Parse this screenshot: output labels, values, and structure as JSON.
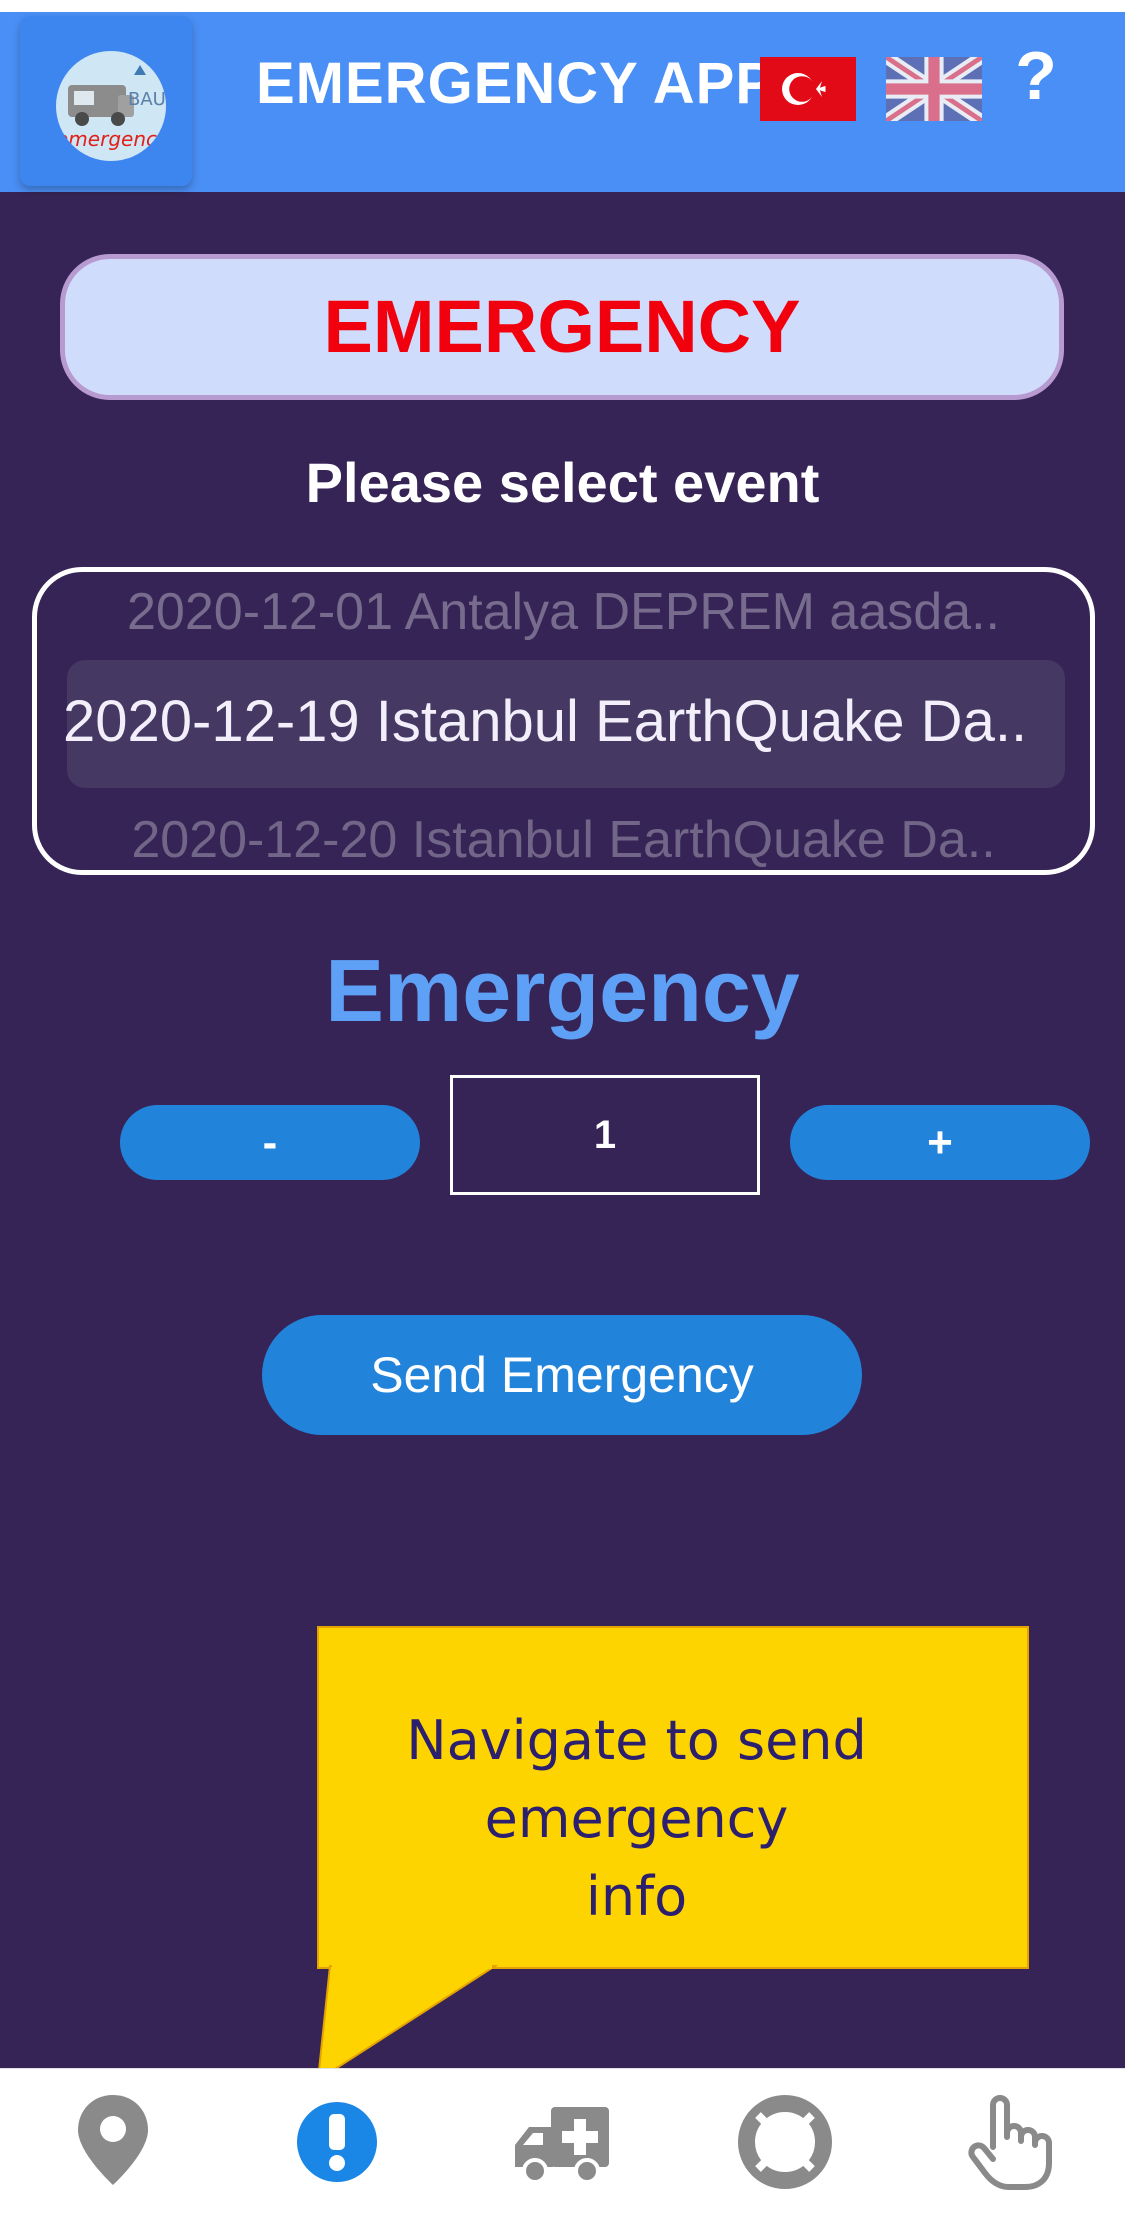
{
  "header": {
    "title": "EMERGENCY APP",
    "logo_text": "emergency",
    "logo_mark": "BAU",
    "help_label": "?",
    "languages": [
      {
        "name": "turkish-flag"
      },
      {
        "name": "uk-flag"
      }
    ]
  },
  "banner": {
    "label": "EMERGENCY"
  },
  "event_select": {
    "prompt": "Please select event",
    "options_visible": [
      "2020-12-01 Antalya DEPREM aasda..",
      "2020-12-19 Istanbul EarthQuake Da..",
      "2020-12-20 Istanbul EarthQuake Da.."
    ],
    "selected": "2020-12-19 Istanbul EarthQuake Da.."
  },
  "counter": {
    "title": "Emergency",
    "minus_label": "-",
    "plus_label": "+",
    "value": "1"
  },
  "send_button": {
    "label": "Send Emergency"
  },
  "callout": {
    "line1": "Navigate to send",
    "line2": "emergency",
    "line3": "info"
  },
  "tabbar": {
    "items": [
      {
        "icon": "location-pin-icon",
        "active": false
      },
      {
        "icon": "exclamation-icon",
        "active": true
      },
      {
        "icon": "ambulance-icon",
        "active": false
      },
      {
        "icon": "lifebuoy-icon",
        "active": false
      },
      {
        "icon": "pointer-hand-icon",
        "active": false
      }
    ]
  },
  "colors": {
    "header_bg": "#4a8ff5",
    "page_bg": "#352455",
    "accent_red": "#f1000e",
    "button_blue": "#2283da",
    "title_blue": "#5fa0f7",
    "callout_yellow": "#fdd400",
    "tab_active": "#1a86e6",
    "tab_inactive": "#8a8a8a"
  }
}
